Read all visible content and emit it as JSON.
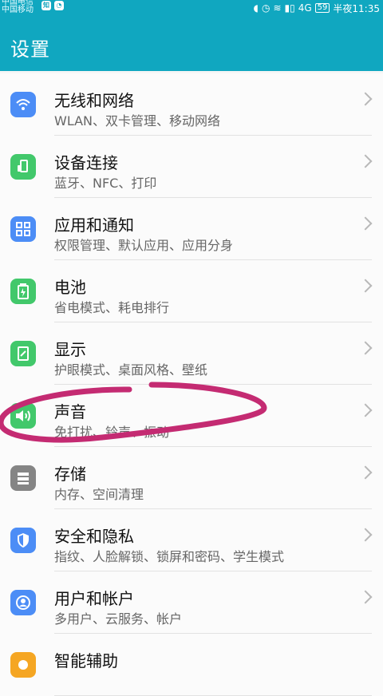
{
  "status_bar": {
    "carrier_top": "中国电信",
    "carrier_bottom": "中国移动",
    "badge": "知",
    "network": "4G",
    "battery": "59",
    "time": "半夜11:35"
  },
  "header": {
    "title": "设置"
  },
  "settings": [
    {
      "title": "无线和网络",
      "subtitle": "WLAN、双卡管理、移动网络",
      "icon": "wifi-icon",
      "color": "#4c8df6"
    },
    {
      "title": "设备连接",
      "subtitle": "蓝牙、NFC、打印",
      "icon": "device-connection-icon",
      "color": "#42c86b"
    },
    {
      "title": "应用和通知",
      "subtitle": "权限管理、默认应用、应用分身",
      "icon": "apps-grid-icon",
      "color": "#4c8df6"
    },
    {
      "title": "电池",
      "subtitle": "省电模式、耗电排行",
      "icon": "battery-icon",
      "color": "#42c86b"
    },
    {
      "title": "显示",
      "subtitle": "护眼模式、桌面风格、壁纸",
      "icon": "display-icon",
      "color": "#42c86b"
    },
    {
      "title": "声音",
      "subtitle": "免打扰、铃声、振动",
      "icon": "sound-icon",
      "color": "#42c86b"
    },
    {
      "title": "存储",
      "subtitle": "内存、空间清理",
      "icon": "storage-icon",
      "color": "#858585"
    },
    {
      "title": "安全和隐私",
      "subtitle": "指纹、人脸解锁、锁屏和密码、学生模式",
      "icon": "shield-icon",
      "color": "#4c8df6"
    },
    {
      "title": "用户和帐户",
      "subtitle": "多用户、云服务、帐户",
      "icon": "user-account-icon",
      "color": "#4c8df6"
    },
    {
      "title": "智能辅助",
      "subtitle": "",
      "icon": "smart-assist-icon",
      "color": "#f5a623"
    }
  ]
}
